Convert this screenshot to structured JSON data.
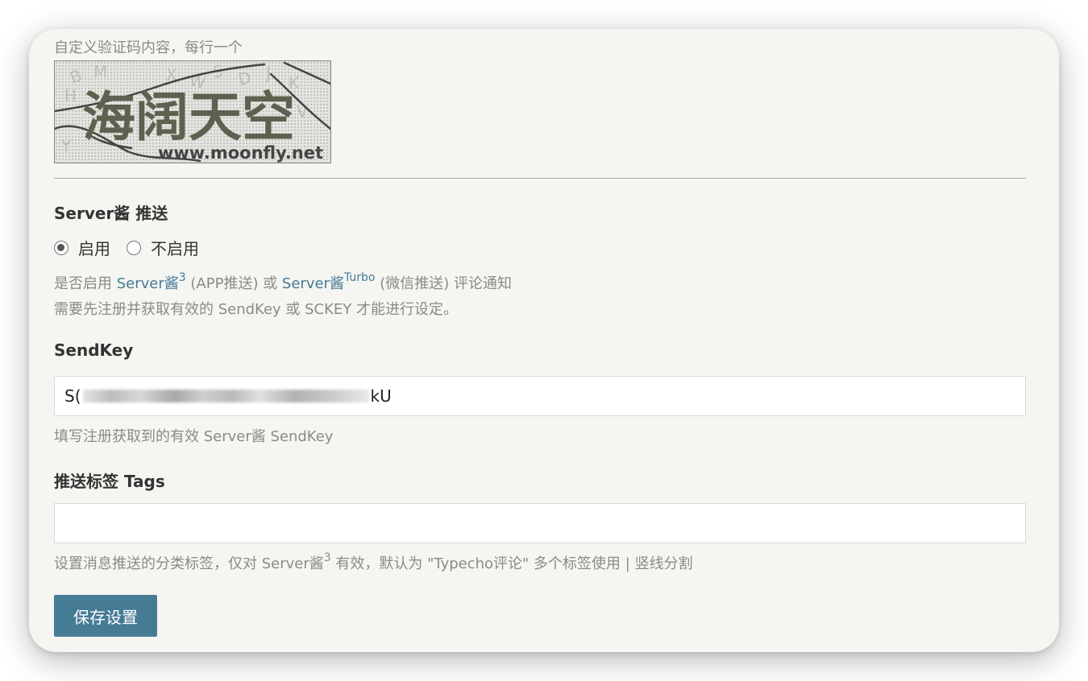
{
  "captcha": {
    "description": "自定义验证码内容，每行一个",
    "image_text": "海阔天空",
    "watermark": "www.moonfly.net"
  },
  "serverchan": {
    "label": "Server酱 推送",
    "options": [
      {
        "label": "启用",
        "checked": true
      },
      {
        "label": "不启用",
        "checked": false
      }
    ],
    "desc_line1": {
      "prefix": "是否启用 ",
      "link1": "Server酱",
      "link1_sup": "3",
      "middle": " (APP推送) 或 ",
      "link2": "Server酱",
      "link2_sup": "Turbo",
      "suffix": " (微信推送) 评论通知"
    },
    "desc_line2": "需要先注册并获取有效的 SendKey 或 SCKEY 才能进行设定。"
  },
  "sendkey": {
    "label": "SendKey",
    "value_prefix": "S(",
    "value_suffix": "kU",
    "description": "填写注册获取到的有效 Server酱 SendKey"
  },
  "tags": {
    "label": "推送标签 Tags",
    "value": "",
    "desc_prefix": "设置消息推送的分类标签，仅对 Server酱",
    "desc_sup": "3",
    "desc_suffix": " 有效，默认为 \"Typecho评论\" 多个标签使用 | 竖线分割"
  },
  "save_label": "保存设置",
  "colors": {
    "accent": "#467b96",
    "card_bg": "#f5f5f1"
  }
}
